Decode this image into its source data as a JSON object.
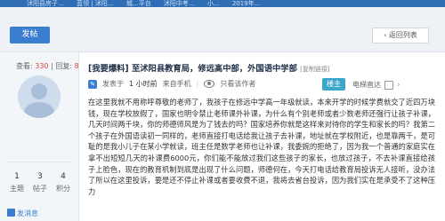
{
  "topbar": {
    "tabs": [
      "沭阳县房子…",
      "蓝领 | 沭阳…",
      "城…平台",
      "沭阳中考…",
      "小…",
      "2019年…"
    ]
  },
  "toolbar": {
    "post_label": "发帖",
    "back_label": "返回列表"
  },
  "sidebar": {
    "views_label": "查看:",
    "views_value": "330",
    "replies_label": "回复:",
    "replies_value": "8",
    "stats": [
      {
        "num": "1",
        "label": "主题"
      },
      {
        "num": "3",
        "label": "帖子"
      },
      {
        "num": "4",
        "label": "积分"
      }
    ],
    "report_label": "发消息"
  },
  "post": {
    "tag": "[我要爆料]",
    "title": "至沭阳县教育局，修远高中部，外国语中学部",
    "copyright": "[复制链接]",
    "meta": {
      "prefix": "发表于",
      "time": "1 小时前",
      "source": "来自手机",
      "mode": "只看该作者"
    },
    "floor_label": "楼主",
    "right_label": "电梯直达",
    "content": "在这里我就不用称呼尊敬的老师了，我孩子在修远中学高一年级就读，本来开学的时候学费就交了近四万块钱，现在学校放假了，国家也明令禁止老师课外补课，为什么有个别老师或者少数老师还强行让孩子补课，几天时间两千块，你的师德师风是为了钱去的吗？国家培养你就是这样来对待你的学生和家长的吗？我第二个孩子在外国语读初一同样的，老师直接打电话给我让孩子去补课，地址就在学校附近，也是靠两千，是可耻的是我小儿子在某小学就读，班主任是数学老师也让补课，我委婉的拒绝了，因为我一个普通的家庭实在拿不出短短几天的补课费6000元，你们能不能放过我们这些孩子的家长，也放过孩子，不去补课直接给孩子上脸色，现在的教育机制到底是出现了什么问题，师德何在，今天打电话给教育局投诉无人接听，没办法了所以在这里投诉，要是还不停止补课或者要收费不退，我将去省台投诉，因为我们实在是承受不了这种压力"
  }
}
